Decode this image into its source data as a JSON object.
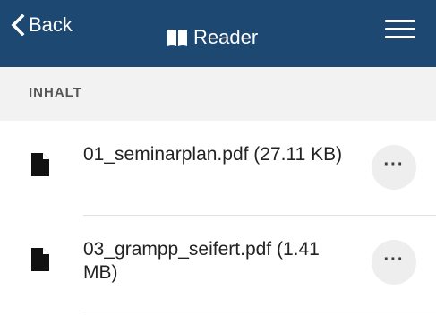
{
  "header": {
    "back_label": "Back",
    "title": "Reader",
    "back_icon": "chevron-left-icon",
    "title_icon": "book-icon",
    "menu_icon": "hamburger-menu-icon",
    "background_color": "#1d4872"
  },
  "section": {
    "label": "INHALT"
  },
  "files": [
    {
      "name": "01_seminarplan.pdf (27.11 KB)",
      "icon": "file-icon",
      "more_label": "···"
    },
    {
      "name": "03_grampp_seifert.pdf (1.41 MB)",
      "icon": "file-icon",
      "more_label": "···"
    }
  ]
}
